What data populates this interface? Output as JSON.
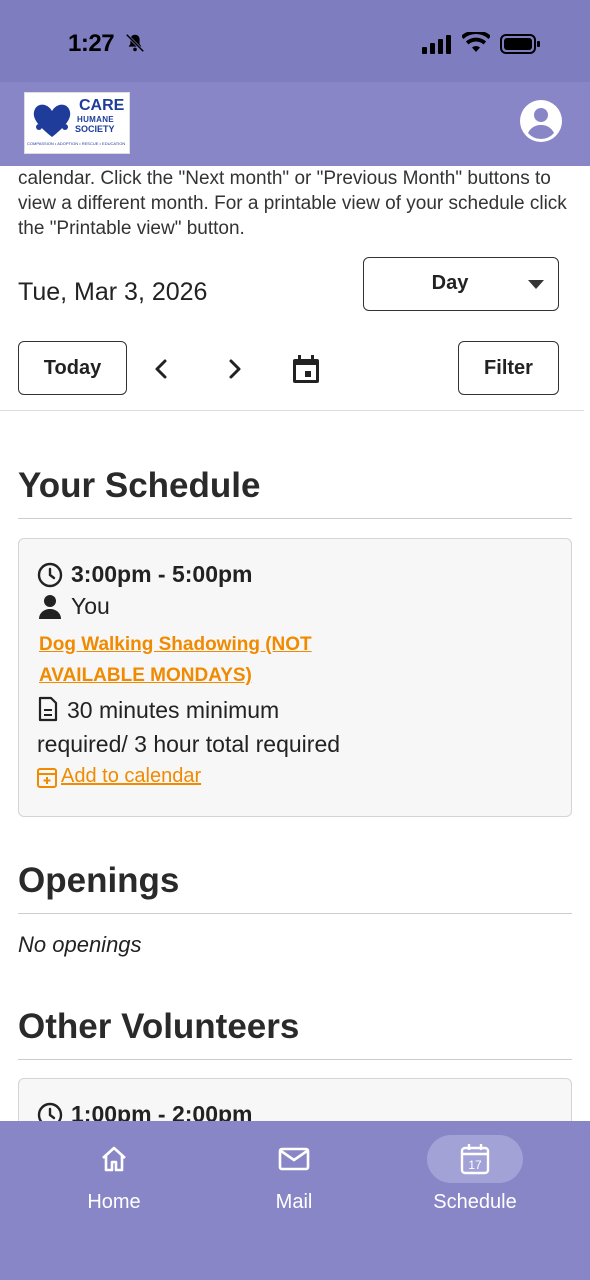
{
  "status_bar": {
    "time": "1:27"
  },
  "header": {
    "logo": {
      "name": "CARE",
      "line2": "HUMANE",
      "line3": "SOCIETY",
      "tagline": "COMPASSION • ADOPTION • RESCUE • EDUCATION"
    }
  },
  "intro_text": "calendar. Click the \"Next month\" or \"Previous Month\" buttons to view a different month. For a printable view of your schedule click the \"Printable view\" button.",
  "date_label": "Tue, Mar 3, 2026",
  "view_select": {
    "value": "Day"
  },
  "toolbar": {
    "today_label": "Today",
    "filter_label": "Filter"
  },
  "your_schedule": {
    "title": "Your Schedule",
    "shift": {
      "time": "3:00pm - 5:00pm",
      "person": "You",
      "name_line1": "Dog Walking Shadowing (NOT",
      "name_line2": "AVAILABLE MONDAYS)",
      "description": "30 minutes minimum required/ 3 hour total required",
      "add_to_calendar": "Add to calendar"
    }
  },
  "openings": {
    "title": "Openings",
    "empty_text": "No openings"
  },
  "other_volunteers": {
    "title": "Other Volunteers",
    "first_time": "1:00pm - 2:00pm"
  },
  "bottom_nav": {
    "items": [
      {
        "label": "Home",
        "icon": "home-icon"
      },
      {
        "label": "Mail",
        "icon": "mail-icon"
      },
      {
        "label": "Schedule",
        "icon": "calendar-icon",
        "badge": "17",
        "active": true
      }
    ]
  },
  "colors": {
    "header": "#8886c7",
    "accent_orange": "#f08a00",
    "status_bar": "#7e7dbf"
  }
}
